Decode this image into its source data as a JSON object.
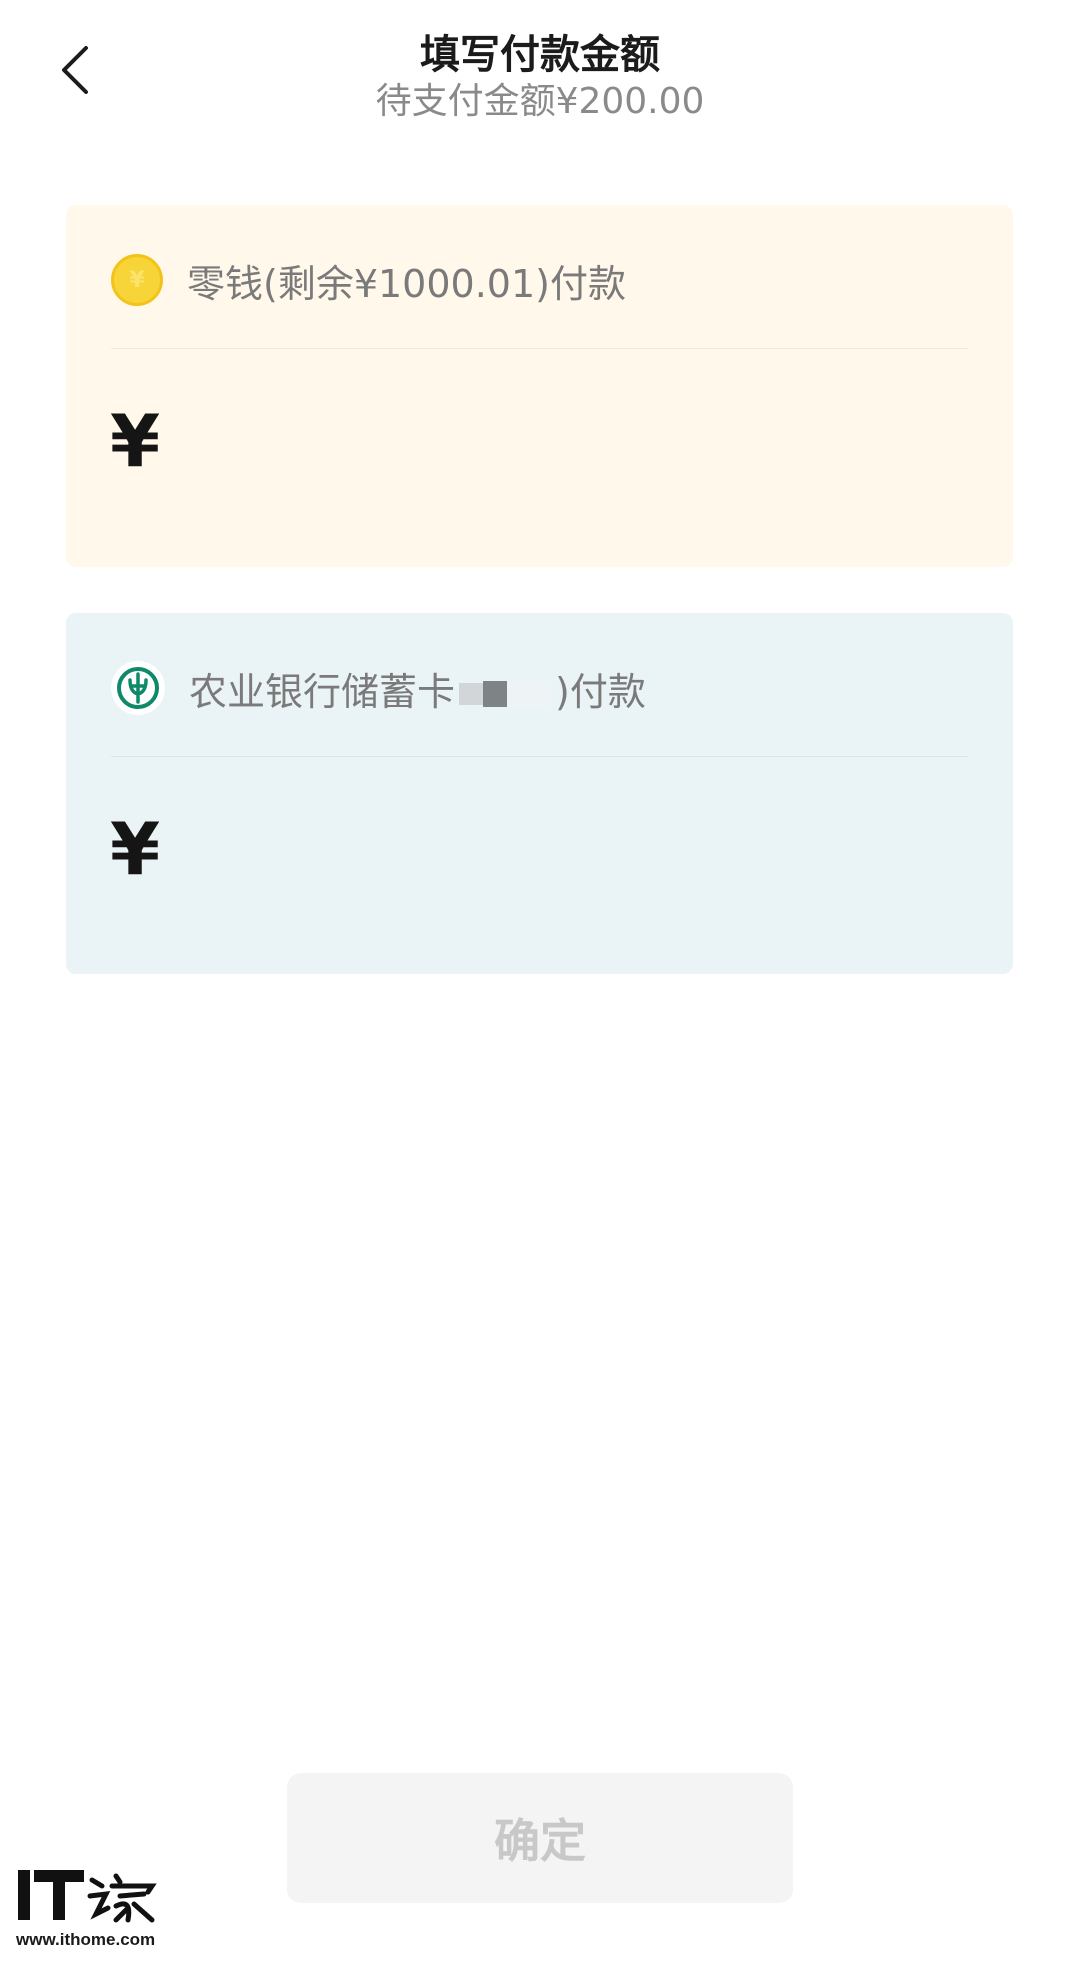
{
  "header": {
    "title": "填写付款金额",
    "subtitle": "待支付金额¥200.00",
    "back_icon": "chevron-left-icon"
  },
  "change_card": {
    "label": "零钱(剩余¥1000.01)付款",
    "icon": "coin-icon",
    "icon_glyph": "¥",
    "currency_symbol": "¥",
    "amount": "",
    "background": "#fff8eb"
  },
  "bank_card": {
    "label_prefix": "农业银行储蓄卡",
    "label_suffix": ")付款",
    "icon": "bank-logo-icon",
    "currency_symbol": "¥",
    "amount": "",
    "background": "#eaf3f5",
    "accent": "#0e8a6a"
  },
  "confirm_button": {
    "label": "确定",
    "enabled": false
  },
  "watermark": {
    "url": "www.ithome.com",
    "logo_text": "IT之家"
  }
}
